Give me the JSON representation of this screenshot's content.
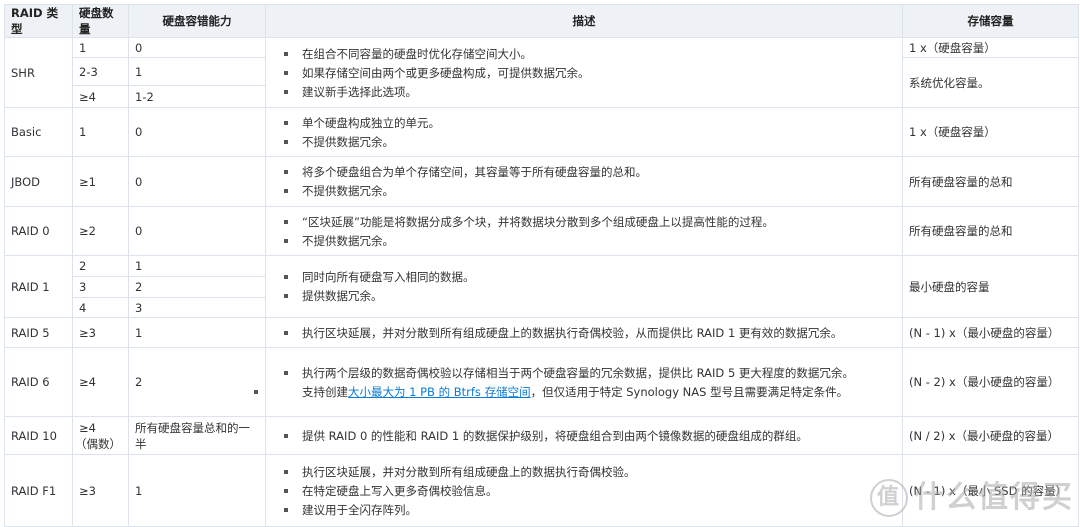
{
  "headers": [
    "RAID 类型",
    "硬盘数量",
    "硬盘容错能力",
    "描述",
    "存储容量"
  ],
  "shr": {
    "type": "SHR",
    "sub": [
      [
        "1",
        "0"
      ],
      [
        "2-3",
        "1"
      ],
      [
        "≥4",
        "1-2"
      ]
    ],
    "desc": [
      "在组合不同容量的硬盘时优化存储空间大小。",
      "如果存储空间由两个或更多硬盘构成，可提供数据冗余。",
      "建议新手选择此选项。"
    ],
    "cap": [
      "1 x（硬盘容量）",
      "系统优化容量。"
    ]
  },
  "basic": {
    "type": "Basic",
    "disks": "1",
    "ft": "0",
    "desc": [
      "单个硬盘构成独立的单元。",
      "不提供数据冗余。"
    ],
    "cap": "1 x（硬盘容量）"
  },
  "jbod": {
    "type": "JBOD",
    "disks": "≥1",
    "ft": "0",
    "desc": [
      "将多个硬盘组合为单个存储空间，其容量等于所有硬盘容量的总和。",
      "不提供数据冗余。"
    ],
    "cap": "所有硬盘容量的总和"
  },
  "raid0": {
    "type": "RAID 0",
    "disks": "≥2",
    "ft": "0",
    "desc": [
      "“区块延展”功能是将数据分成多个块，并将数据块分散到多个组成硬盘上以提高性能的过程。",
      "不提供数据冗余。"
    ],
    "cap": "所有硬盘容量的总和"
  },
  "raid1": {
    "type": "RAID 1",
    "sub": [
      [
        "2",
        "1"
      ],
      [
        "3",
        "2"
      ],
      [
        "4",
        "3"
      ]
    ],
    "desc": [
      "同时向所有硬盘写入相同的数据。",
      "提供数据冗余。"
    ],
    "cap": "最小硬盘的容量"
  },
  "raid5": {
    "type": "RAID 5",
    "disks": "≥3",
    "ft": "1",
    "desc": [
      "执行区块延展，并对分散到所有组成硬盘上的数据执行奇偶校验，从而提供比 RAID 1 更有效的数据冗余。"
    ],
    "cap": "(N - 1) x（最小硬盘的容量）"
  },
  "raid6": {
    "type": "RAID 6",
    "disks": "≥4",
    "ft": "2",
    "desc": [
      "执行两个层级的数据奇偶校验以存储相当于两个硬盘容量的冗余数据，提供比 RAID 5 更大程度的数据冗余。"
    ],
    "desc2_pre": "支持创建",
    "desc2_link": "大小最大为 1 PB 的 Btrfs 存储空间",
    "desc2_post": "，但仅适用于特定 Synology NAS 型号且需要满足特定条件。",
    "cap": "(N - 2) x（最小硬盘的容量）"
  },
  "raid10": {
    "type": "RAID 10",
    "disks": "≥4",
    "disks2": "（偶数）",
    "ft": "所有硬盘容量总和的一半",
    "desc": [
      "提供 RAID 0 的性能和 RAID 1 的数据保护级别，将硬盘组合到由两个镜像数据的硬盘组成的群组。"
    ],
    "cap": "(N / 2) x（最小硬盘的容量）"
  },
  "raidf1": {
    "type": "RAID F1",
    "disks": "≥3",
    "ft": "1",
    "desc": [
      "执行区块延展，并对分散到所有组成硬盘上的数据执行奇偶校验。",
      "在特定硬盘上写入更多奇偶校验信息。",
      "建议用于全闪存阵列。"
    ],
    "cap": "(N - 1) x（最小 SSD 的容量）"
  },
  "watermark": {
    "logo": "值",
    "text": "什么值得买"
  }
}
